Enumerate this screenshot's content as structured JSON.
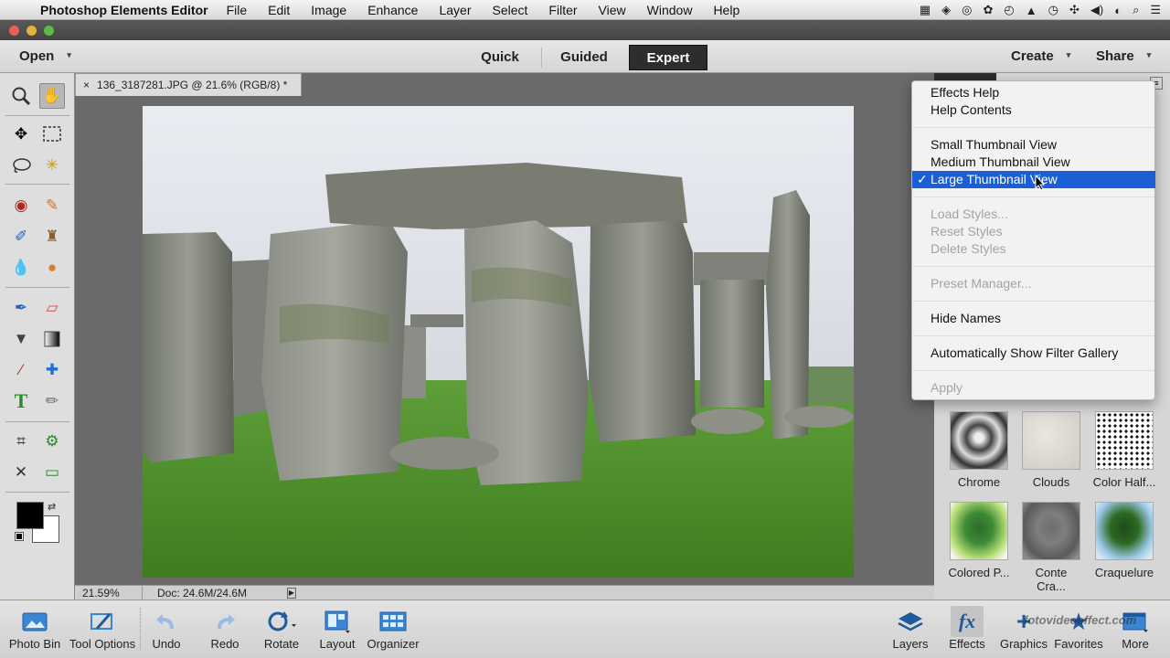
{
  "menubar": {
    "apple": "",
    "app_name": "Photoshop Elements Editor",
    "items": [
      "File",
      "Edit",
      "Image",
      "Enhance",
      "Layer",
      "Select",
      "Filter",
      "View",
      "Window",
      "Help"
    ]
  },
  "modebar": {
    "open_label": "Open",
    "modes": [
      "Quick",
      "Guided",
      "Expert"
    ],
    "selected_mode": "Expert",
    "create_label": "Create",
    "share_label": "Share"
  },
  "document": {
    "tab_title": "136_3187281.JPG @ 21.6% (RGB/8) *",
    "close_glyph": "×",
    "zoom": "21.59%",
    "doc_info": "Doc: 24.6M/24.6M"
  },
  "context_menu": {
    "groups": [
      [
        {
          "label": "Effects Help",
          "enabled": true
        },
        {
          "label": "Help Contents",
          "enabled": true
        }
      ],
      [
        {
          "label": "Small Thumbnail View",
          "enabled": true
        },
        {
          "label": "Medium Thumbnail View",
          "enabled": true
        },
        {
          "label": "Large Thumbnail View",
          "enabled": true,
          "checked": true,
          "highlighted": true
        }
      ],
      [
        {
          "label": "Load Styles...",
          "enabled": false
        },
        {
          "label": "Reset Styles",
          "enabled": false
        },
        {
          "label": "Delete Styles",
          "enabled": false
        }
      ],
      [
        {
          "label": "Preset Manager...",
          "enabled": false
        }
      ],
      [
        {
          "label": "Hide Names",
          "enabled": true
        }
      ],
      [
        {
          "label": "Automatically Show Filter Gallery",
          "enabled": true
        }
      ],
      [
        {
          "label": "Apply",
          "enabled": false
        }
      ]
    ],
    "check_glyph": "✓"
  },
  "effects_thumbnails": [
    "Chrome",
    "Clouds",
    "Color Half...",
    "Colored P...",
    "Conte Cra...",
    "Craquelure"
  ],
  "bottom_bar": {
    "left": [
      "Photo Bin",
      "Tool Options",
      "Undo",
      "Redo",
      "Rotate",
      "Layout",
      "Organizer"
    ],
    "right": [
      "Layers",
      "Effects",
      "Graphics",
      "Favorites",
      "More"
    ]
  },
  "watermark": "fotovideoeffect.com",
  "colors": {
    "highlight": "#1a5fd6",
    "mode_selected_bg": "#2d2d2d",
    "foreground_swatch": "#000000",
    "background_swatch": "#ffffff"
  }
}
